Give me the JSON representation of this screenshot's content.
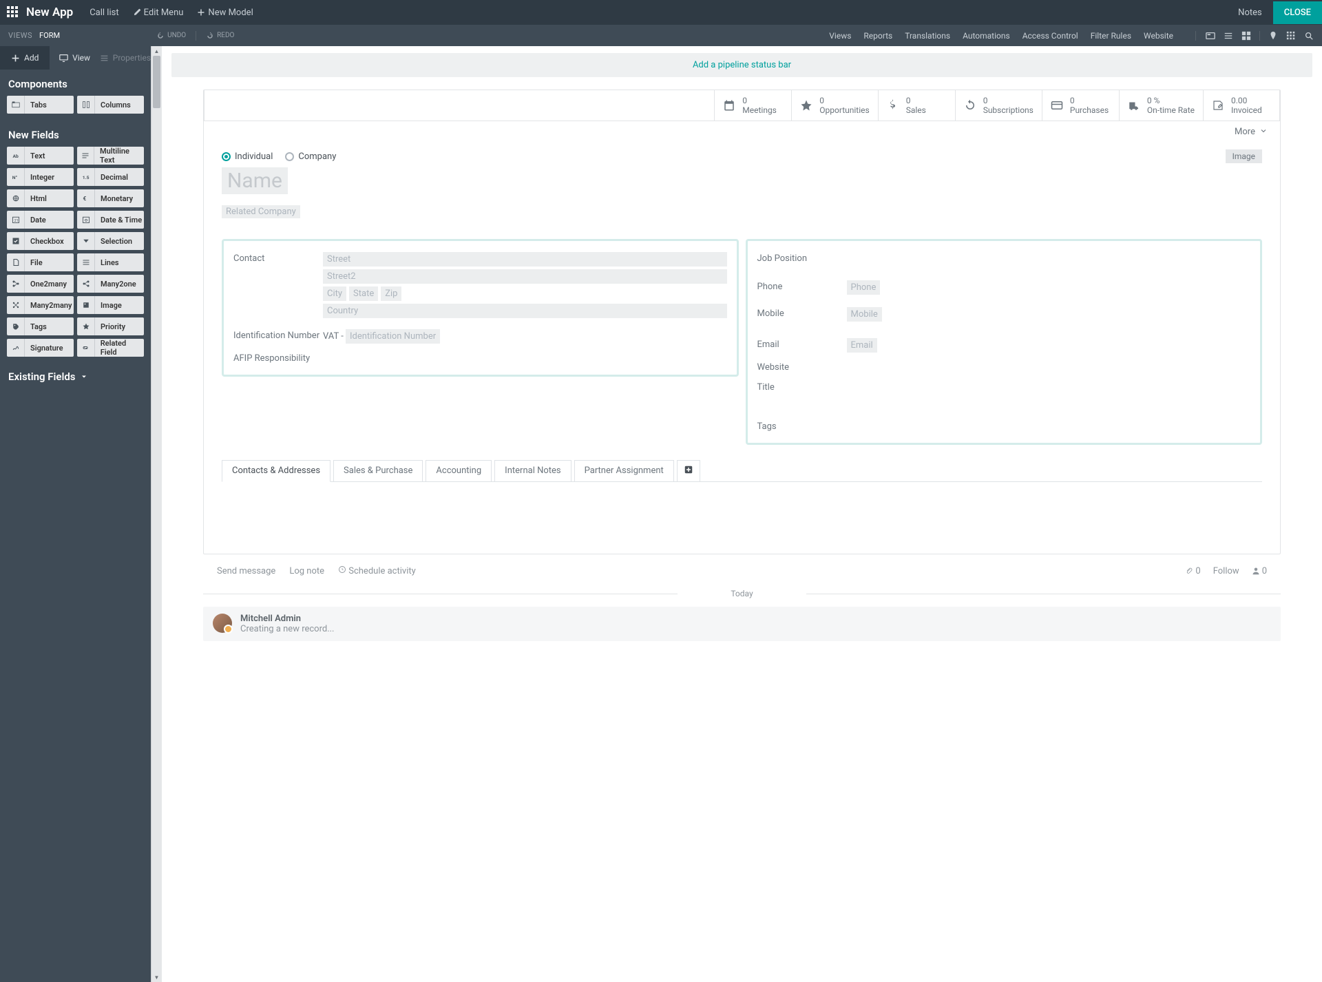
{
  "topbar": {
    "app_title": "New App",
    "call_list": "Call list",
    "edit_menu": "Edit Menu",
    "new_model": "New Model",
    "notes": "Notes",
    "close": "CLOSE"
  },
  "subbar": {
    "views": "VIEWS",
    "form": "FORM",
    "undo": "UNDO",
    "redo": "REDO",
    "links": [
      "Views",
      "Reports",
      "Translations",
      "Automations",
      "Access Control",
      "Filter Rules",
      "Website"
    ]
  },
  "sidebar": {
    "tabs": {
      "add": "Add",
      "view": "View",
      "properties": "Properties"
    },
    "components_title": "Components",
    "components": [
      "Tabs",
      "Columns"
    ],
    "new_fields_title": "New Fields",
    "fields": [
      "Text",
      "Multiline Text",
      "Integer",
      "Decimal",
      "Html",
      "Monetary",
      "Date",
      "Date & Time",
      "Checkbox",
      "Selection",
      "File",
      "Lines",
      "One2many",
      "Many2one",
      "Many2many",
      "Image",
      "Tags",
      "Priority",
      "Signature",
      "Related Field"
    ],
    "existing_fields": "Existing Fields"
  },
  "form": {
    "pipeline_placeholder": "Add a pipeline status bar",
    "stats": [
      {
        "value": "0",
        "label": "Meetings"
      },
      {
        "value": "0",
        "label": "Opportunities"
      },
      {
        "value": "0",
        "label": "Sales"
      },
      {
        "value": "0",
        "label": "Subscriptions"
      },
      {
        "value": "0",
        "label": "Purchases"
      },
      {
        "value": "0 %",
        "label": "On-time Rate"
      },
      {
        "value": "0.00",
        "label": "Invoiced"
      }
    ],
    "more": "More",
    "type": {
      "individual": "Individual",
      "company": "Company"
    },
    "image_chip": "Image",
    "name_placeholder": "Name",
    "related_company": "Related Company",
    "left": {
      "contact": "Contact",
      "street": "Street",
      "street2": "Street2",
      "city": "City",
      "state": "State",
      "zip": "Zip",
      "country": "Country",
      "id_number_label": "Identification Number",
      "vat_prefix": "VAT - ",
      "vat_placeholder": "Identification Number",
      "afip": "AFIP Responsibility"
    },
    "right": {
      "job_position": "Job Position",
      "phone": "Phone",
      "phone_ph": "Phone",
      "mobile": "Mobile",
      "mobile_ph": "Mobile",
      "email": "Email",
      "email_ph": "Email",
      "website": "Website",
      "title": "Title",
      "tags": "Tags"
    },
    "tabs": [
      "Contacts & Addresses",
      "Sales & Purchase",
      "Accounting",
      "Internal Notes",
      "Partner Assignment"
    ]
  },
  "chatter": {
    "send": "Send message",
    "log": "Log note",
    "schedule": "Schedule activity",
    "attach_count": "0",
    "follow": "Follow",
    "followers_count": "0",
    "today": "Today",
    "author": "Mitchell Admin",
    "message": "Creating a new record..."
  }
}
